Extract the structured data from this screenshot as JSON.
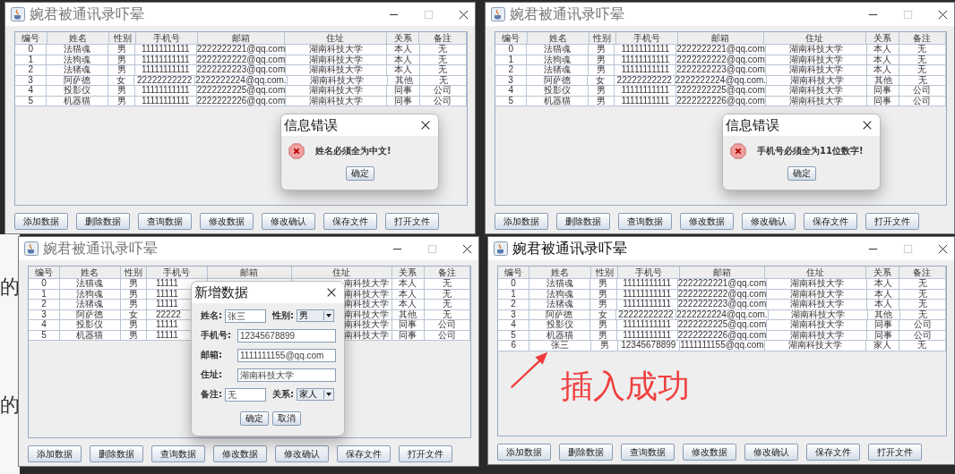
{
  "background_page": {
    "texts": [
      "的",
      "的"
    ]
  },
  "windows": [
    {
      "title": "婉君被通讯录吓晕",
      "columns": [
        "编号",
        "姓名",
        "性别",
        "手机号",
        "邮箱",
        "住址",
        "关系",
        "备注"
      ],
      "rows": [
        {
          "id": "0",
          "name": "法猫魂",
          "gender": "男",
          "phone": "11111111111",
          "email": "2222222221@qq.com",
          "address": "湖南科技大学",
          "relation": "本人",
          "note": "无"
        },
        {
          "id": "1",
          "name": "法狗魂",
          "gender": "男",
          "phone": "11111111111",
          "email": "2222222222@qq.com",
          "address": "湖南科技大学",
          "relation": "本人",
          "note": "无"
        },
        {
          "id": "2",
          "name": "法猪魂",
          "gender": "男",
          "phone": "11111111111",
          "email": "2222222223@qq.com",
          "address": "湖南科技大学",
          "relation": "本人",
          "note": "无"
        },
        {
          "id": "3",
          "name": "阿萨德",
          "gender": "女",
          "phone": "22222222222",
          "email": "2222222224@qq.com.",
          "address": "湖南科技大学",
          "relation": "其他",
          "note": "无"
        },
        {
          "id": "4",
          "name": "投影仪",
          "gender": "男",
          "phone": "11111111111",
          "email": "2222222225@qq.com",
          "address": "湖南科技大学",
          "relation": "同事",
          "note": "公司"
        },
        {
          "id": "5",
          "name": "机器猫",
          "gender": "男",
          "phone": "11111111111",
          "email": "2222222226@qq.com",
          "address": "湖南科技大学",
          "relation": "同事",
          "note": "公司"
        }
      ],
      "buttons": [
        "添加数据",
        "删除数据",
        "查询数据",
        "修改数据",
        "修改确认",
        "保存文件",
        "打开文件"
      ],
      "dialog": {
        "kind": "error",
        "title": "信息错误",
        "message": "姓名必须全为中文!",
        "buttons": [
          "确定"
        ]
      }
    },
    {
      "title": "婉君被通讯录吓晕",
      "columns": [
        "编号",
        "姓名",
        "性别",
        "手机号",
        "邮箱",
        "住址",
        "关系",
        "备注"
      ],
      "rows": [
        {
          "id": "0",
          "name": "法猫魂",
          "gender": "男",
          "phone": "11111111111",
          "email": "2222222221@qq.com",
          "address": "湖南科技大学",
          "relation": "本人",
          "note": "无"
        },
        {
          "id": "1",
          "name": "法狗魂",
          "gender": "男",
          "phone": "11111111111",
          "email": "2222222222@qq.com",
          "address": "湖南科技大学",
          "relation": "本人",
          "note": "无"
        },
        {
          "id": "2",
          "name": "法猪魂",
          "gender": "男",
          "phone": "11111111111",
          "email": "2222222223@qq.com",
          "address": "湖南科技大学",
          "relation": "本人",
          "note": "无"
        },
        {
          "id": "3",
          "name": "阿萨德",
          "gender": "女",
          "phone": "22222222222",
          "email": "2222222224@qq.com.",
          "address": "湖南科技大学",
          "relation": "其他",
          "note": "无"
        },
        {
          "id": "4",
          "name": "投影仪",
          "gender": "男",
          "phone": "11111111111",
          "email": "2222222225@qq.com",
          "address": "湖南科技大学",
          "relation": "同事",
          "note": "公司"
        },
        {
          "id": "5",
          "name": "机器猫",
          "gender": "男",
          "phone": "11111111111",
          "email": "2222222226@qq.com",
          "address": "湖南科技大学",
          "relation": "同事",
          "note": "公司"
        }
      ],
      "buttons": [
        "添加数据",
        "删除数据",
        "查询数据",
        "修改数据",
        "修改确认",
        "保存文件",
        "打开文件"
      ],
      "dialog": {
        "kind": "error",
        "title": "信息错误",
        "message": "手机号必须全为11位数字!",
        "buttons": [
          "确定"
        ]
      }
    },
    {
      "title": "婉君被通讯录吓晕",
      "columns": [
        "编号",
        "姓名",
        "性别",
        "手机号",
        "邮箱",
        "住址",
        "关系",
        "备注"
      ],
      "rows": [
        {
          "id": "0",
          "name": "法猫魂",
          "gender": "男",
          "phone": "11111",
          "address": "南科技大学",
          "relation": "本人",
          "note": "无"
        },
        {
          "id": "1",
          "name": "法狗魂",
          "gender": "男",
          "phone": "11111",
          "address": "南科技大学",
          "relation": "本人",
          "note": "无"
        },
        {
          "id": "2",
          "name": "法猪魂",
          "gender": "男",
          "phone": "11111",
          "address": "南科技大学",
          "relation": "本人",
          "note": "无"
        },
        {
          "id": "3",
          "name": "阿萨德",
          "gender": "女",
          "phone": "22222",
          "address": "南科技大学",
          "relation": "其他",
          "note": "无"
        },
        {
          "id": "4",
          "name": "投影仪",
          "gender": "男",
          "phone": "11111",
          "address": "南科技大学",
          "relation": "同事",
          "note": "公司"
        },
        {
          "id": "5",
          "name": "机器猫",
          "gender": "男",
          "phone": "11111",
          "address": "南科技大学",
          "relation": "同事",
          "note": "公司"
        }
      ],
      "buttons": [
        "添加数据",
        "删除数据",
        "查询数据",
        "修改数据",
        "修改确认",
        "保存文件",
        "打开文件"
      ],
      "dialog": {
        "kind": "form",
        "title": "新增数据",
        "fields": [
          [
            {
              "label": "姓名:",
              "value": "张三",
              "kind": "text"
            },
            {
              "label": "性别:",
              "value": "男",
              "kind": "select"
            }
          ],
          [
            {
              "label": "手机号:",
              "value": "12345678899",
              "kind": "text"
            }
          ],
          [
            {
              "label": "邮箱:",
              "value": "1111111155@qq.com",
              "kind": "text"
            }
          ],
          [
            {
              "label": "住址:",
              "value": "湖南科技大学",
              "kind": "text"
            }
          ],
          [
            {
              "label": "备注:",
              "value": "无",
              "kind": "text"
            },
            {
              "label": "关系:",
              "value": "家人",
              "kind": "select"
            }
          ]
        ],
        "buttons": [
          "确定",
          "取消"
        ]
      }
    },
    {
      "title": "婉君被通讯录吓晕",
      "columns": [
        "编号",
        "姓名",
        "性别",
        "手机号",
        "邮箱",
        "住址",
        "关系",
        "备注"
      ],
      "rows": [
        {
          "id": "0",
          "name": "法猫魂",
          "gender": "男",
          "phone": "11111111111",
          "email": "2222222221@qq.com",
          "address": "湖南科技大学",
          "relation": "本人",
          "note": "无"
        },
        {
          "id": "1",
          "name": "法狗魂",
          "gender": "男",
          "phone": "11111111111",
          "email": "2222222222@qq.com",
          "address": "湖南科技大学",
          "relation": "本人",
          "note": "无"
        },
        {
          "id": "2",
          "name": "法猪魂",
          "gender": "男",
          "phone": "11111111111",
          "email": "2222222223@qq.com",
          "address": "湖南科技大学",
          "relation": "本人",
          "note": "无"
        },
        {
          "id": "3",
          "name": "阿萨德",
          "gender": "女",
          "phone": "22222222222",
          "email": "2222222224@qq.com.",
          "address": "湖南科技大学",
          "relation": "其他",
          "note": "无"
        },
        {
          "id": "4",
          "name": "投影仪",
          "gender": "男",
          "phone": "11111111111",
          "email": "2222222225@qq.com",
          "address": "湖南科技大学",
          "relation": "同事",
          "note": "公司"
        },
        {
          "id": "5",
          "name": "机器猫",
          "gender": "男",
          "phone": "11111111111",
          "email": "2222222226@qq.com",
          "address": "湖南科技大学",
          "relation": "同事",
          "note": "公司"
        },
        {
          "id": "6",
          "name": "张三",
          "gender": "男",
          "phone": "12345678899",
          "email": "1111111155@qq.com",
          "address": "湖南科技大学",
          "relation": "家人",
          "note": "无"
        }
      ],
      "buttons": [
        "添加数据",
        "删除数据",
        "查询数据",
        "修改数据",
        "修改确认",
        "保存文件",
        "打开文件"
      ],
      "annotation": {
        "text": "插入成功"
      }
    }
  ]
}
